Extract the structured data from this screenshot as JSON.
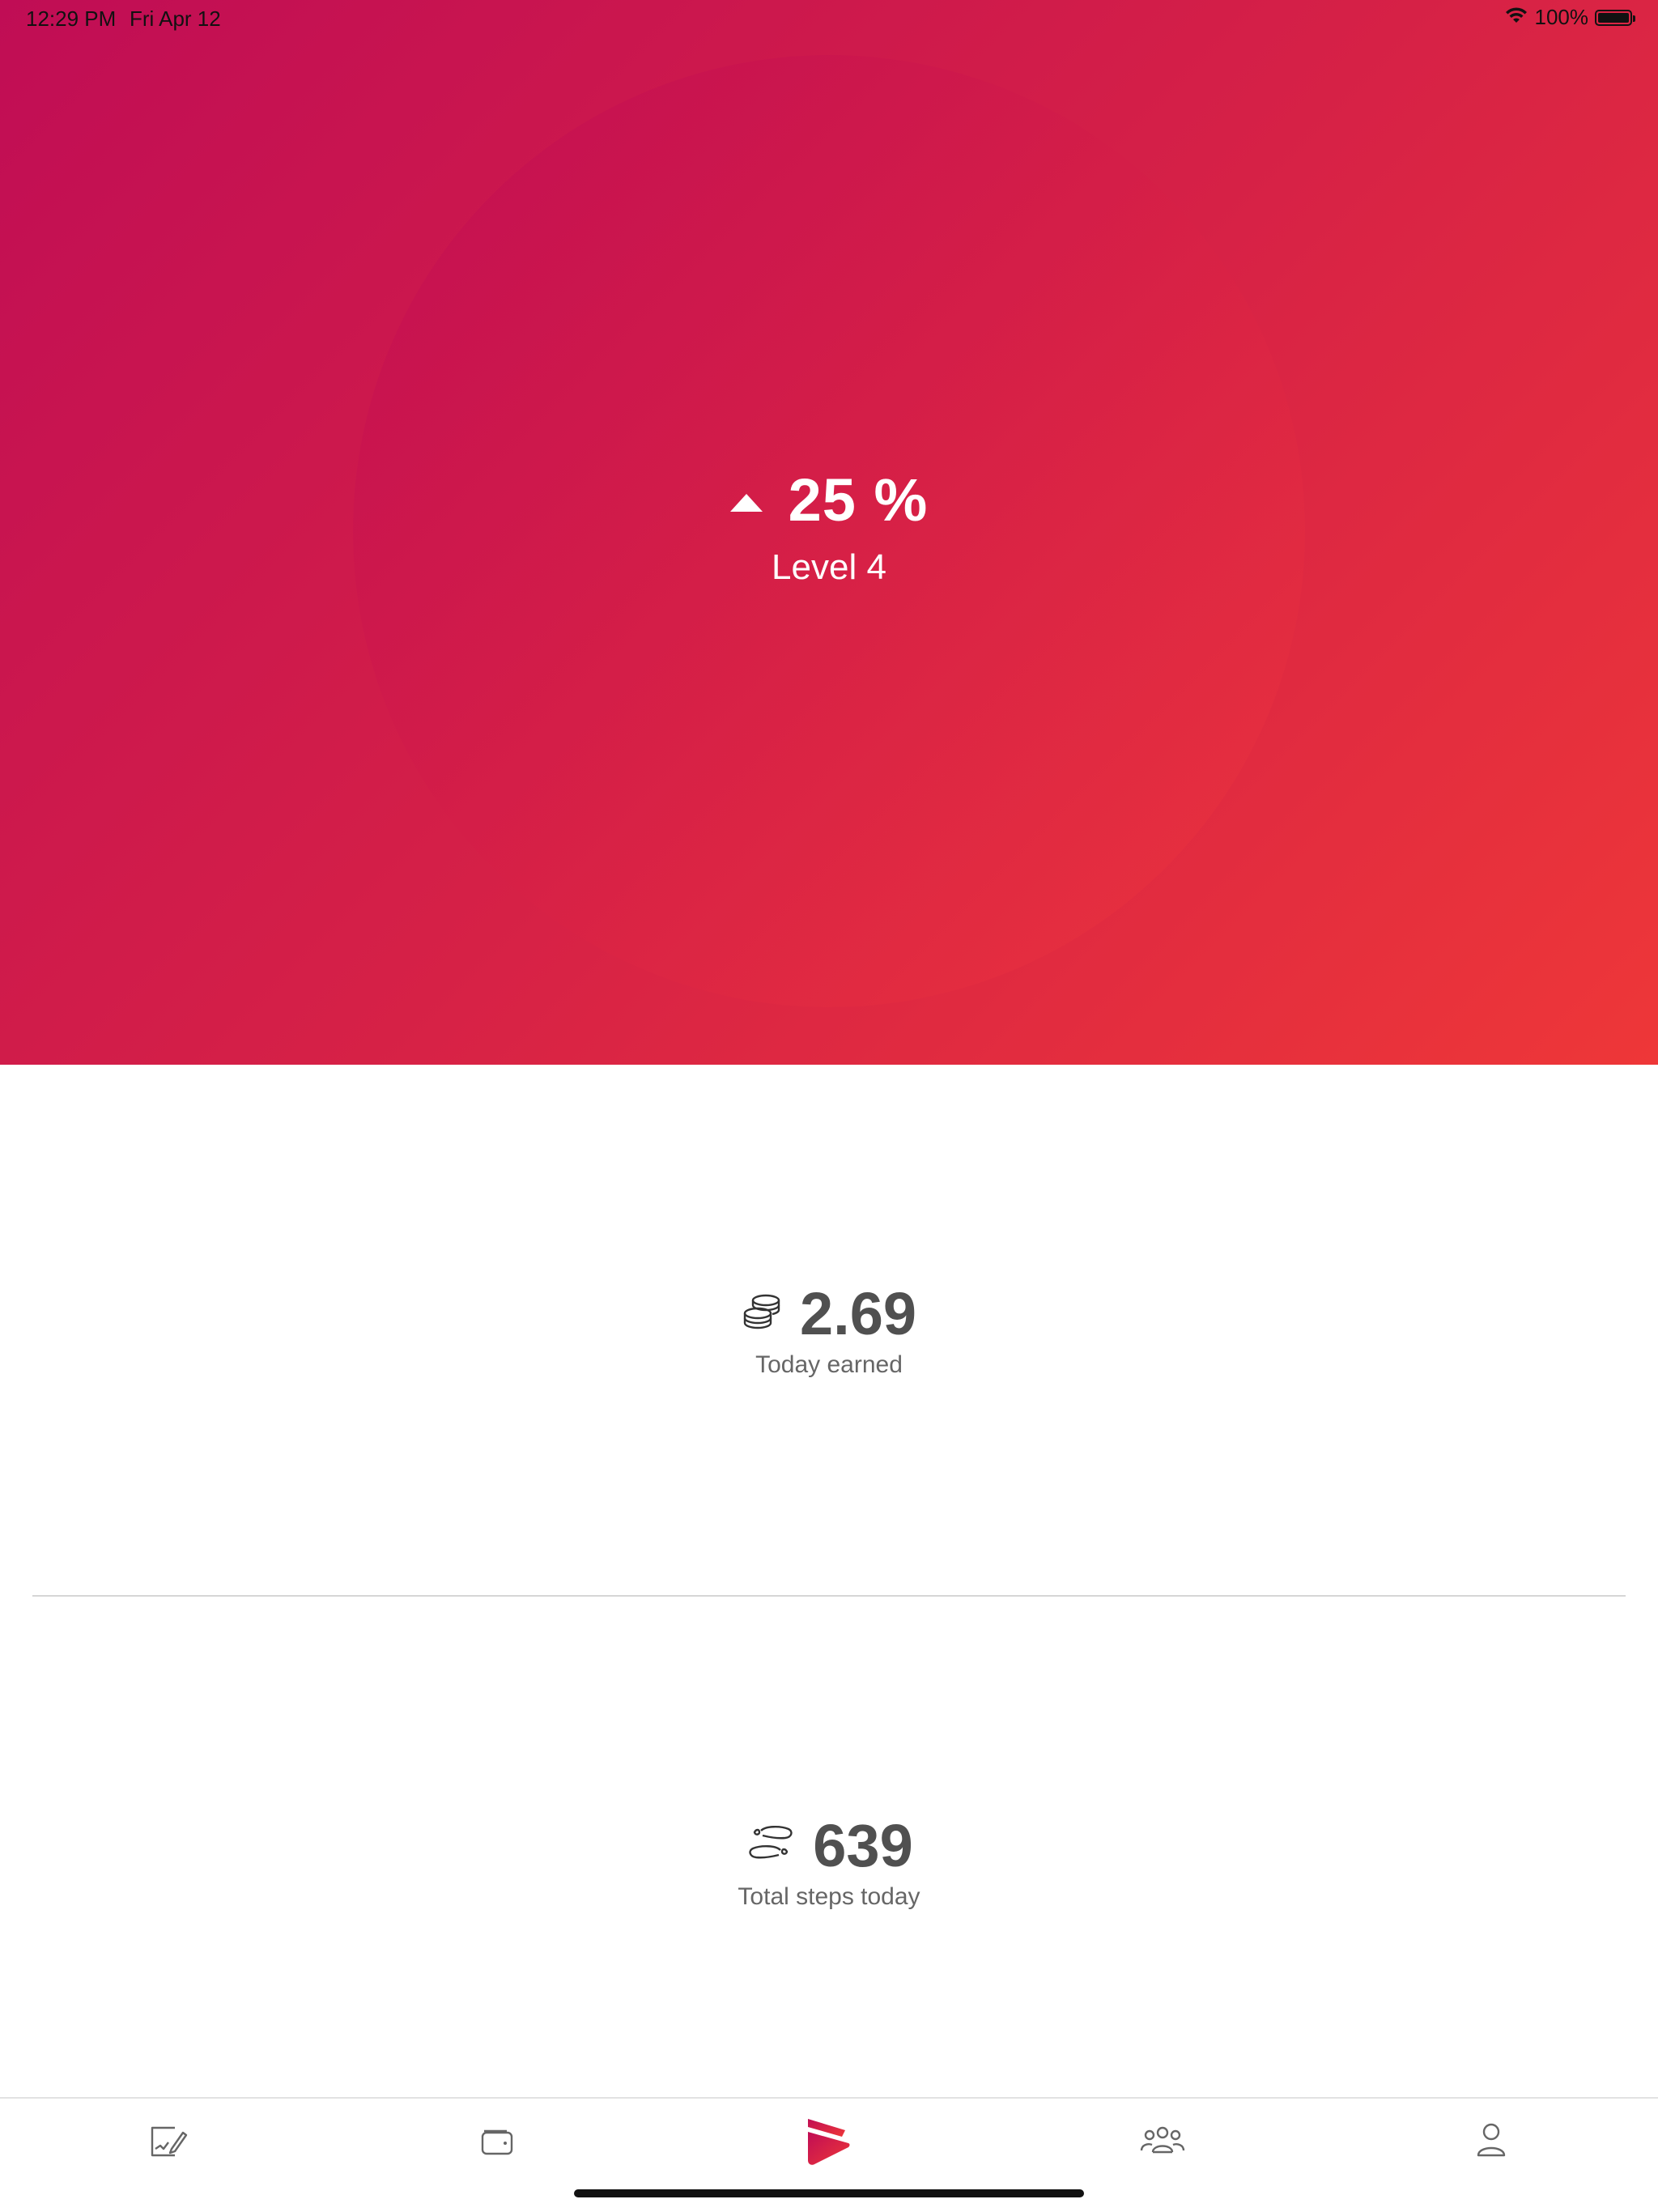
{
  "status_bar": {
    "time": "12:29 PM",
    "date": "Fri Apr 12",
    "battery_text": "100%",
    "battery_level": 1.0
  },
  "level": {
    "trend_icon": "up-triangle-icon",
    "percent": "25 %",
    "label": "Level 4"
  },
  "earned": {
    "icon": "coins-icon",
    "value": "2.69",
    "label": "Today earned"
  },
  "steps": {
    "icon": "footsteps-icon",
    "value": "639",
    "label": "Total steps today"
  },
  "tab_bar": {
    "tabs": [
      {
        "icon": "chart-edit-icon"
      },
      {
        "icon": "wallet-icon"
      },
      {
        "icon": "app-logo-icon",
        "active": true
      },
      {
        "icon": "community-icon"
      },
      {
        "icon": "profile-icon"
      }
    ]
  },
  "colors": {
    "gradient_start": "#c00d55",
    "gradient_end": "#ee3738",
    "accent": "#e0264a",
    "text_dark": "#505050",
    "text_label": "#666666"
  }
}
